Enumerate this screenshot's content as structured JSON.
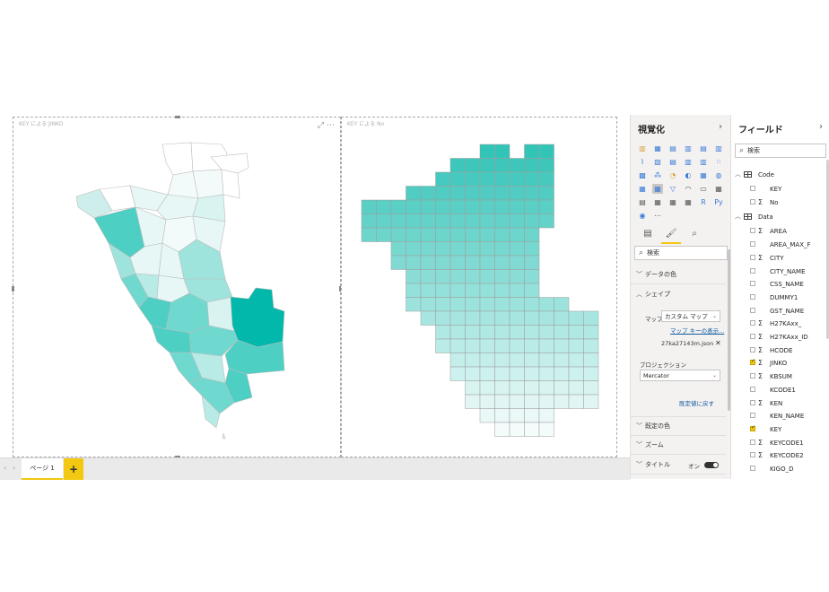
{
  "visuals": {
    "left_title": "KEY による JINKO",
    "right_title": "KEY による No"
  },
  "pages": {
    "tab_label": "ページ 1",
    "add_label": "+"
  },
  "visualizations": {
    "title": "視覚化",
    "search_placeholder": "検索",
    "sections": {
      "data_colors": "データの色",
      "shape": "シェイプ",
      "default_colors": "既定の色",
      "zoom": "ズーム",
      "title": "タイトル"
    },
    "shape": {
      "map_label": "マップ",
      "map_value": "カスタム マップ",
      "map_keys_link": "マップ キーの表示...",
      "file_name": "27ka27143m.json",
      "projection_label": "プロジェクション",
      "projection_value": "Mercator",
      "reset_link": "既定値に戻す"
    },
    "title_toggle": "オン"
  },
  "fields": {
    "title": "フィールド",
    "search_placeholder": "検索",
    "tables": [
      {
        "name": "Code",
        "fields": [
          {
            "name": "KEY",
            "sigma": false,
            "checked": false
          },
          {
            "name": "No",
            "sigma": true,
            "checked": false
          }
        ]
      },
      {
        "name": "Data",
        "fields": [
          {
            "name": "AREA",
            "sigma": true,
            "checked": false
          },
          {
            "name": "AREA_MAX_F",
            "sigma": false,
            "checked": false
          },
          {
            "name": "CITY",
            "sigma": true,
            "checked": false
          },
          {
            "name": "CITY_NAME",
            "sigma": false,
            "checked": false
          },
          {
            "name": "CSS_NAME",
            "sigma": false,
            "checked": false
          },
          {
            "name": "DUMMY1",
            "sigma": false,
            "checked": false
          },
          {
            "name": "GST_NAME",
            "sigma": false,
            "checked": false
          },
          {
            "name": "H27KAxx_",
            "sigma": true,
            "checked": false
          },
          {
            "name": "H27KAxx_ID",
            "sigma": true,
            "checked": false
          },
          {
            "name": "HCODE",
            "sigma": true,
            "checked": false
          },
          {
            "name": "JINKO",
            "sigma": true,
            "checked": true
          },
          {
            "name": "KBSUM",
            "sigma": true,
            "checked": false
          },
          {
            "name": "KCODE1",
            "sigma": false,
            "checked": false
          },
          {
            "name": "KEN",
            "sigma": true,
            "checked": false
          },
          {
            "name": "KEN_NAME",
            "sigma": false,
            "checked": false
          },
          {
            "name": "KEY",
            "sigma": false,
            "checked": true
          },
          {
            "name": "KEYCODE1",
            "sigma": true,
            "checked": false
          },
          {
            "name": "KEYCODE2",
            "sigma": true,
            "checked": false
          },
          {
            "name": "KIGO_D",
            "sigma": false,
            "checked": false
          }
        ]
      }
    ]
  },
  "colors": {
    "accent": "#f2c811",
    "teal_dark": "#01b8aa",
    "teal_light": "#e6f7f6"
  }
}
